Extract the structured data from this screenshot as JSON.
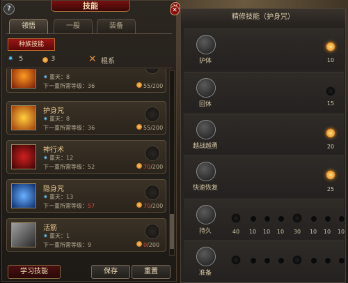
{
  "left": {
    "help": "?",
    "title": "技能",
    "tabs": [
      "领悟",
      "一般",
      "装备"
    ],
    "race_tab": "种族技能",
    "stats": {
      "blue": "5",
      "orange": "3",
      "weapon": "棍系"
    },
    "cards": [
      {
        "name": "",
        "lvl": "重天：8",
        "need_label": "下一重所需等级：",
        "need": "36",
        "need_red": false,
        "pts_cur": "55",
        "pts_max": "/200",
        "pts_red": false,
        "icon": "fire-skill-icon"
      },
      {
        "name": "护身咒",
        "lvl": "重天：8",
        "need_label": "下一重所需等级：",
        "need": "36",
        "need_red": false,
        "pts_cur": "55",
        "pts_max": "/200",
        "pts_red": false,
        "icon": "shield-spell-icon"
      },
      {
        "name": "神行术",
        "lvl": "重天：12",
        "need_label": "下一重所需等级：",
        "need": "52",
        "need_red": false,
        "pts_cur": "70",
        "pts_max": "/200",
        "pts_red": true,
        "icon": "swift-walk-icon"
      },
      {
        "name": "隐身咒",
        "lvl": "重天：13",
        "need_label": "下一重所需等级：",
        "need": "57",
        "need_red": true,
        "pts_cur": "70",
        "pts_max": "/200",
        "pts_red": true,
        "icon": "stealth-spell-icon"
      },
      {
        "name": "活筋",
        "lvl": "重天：1",
        "need_label": "下一重所需等级：",
        "need": "9",
        "need_red": false,
        "pts_cur": "0",
        "pts_max": "/200",
        "pts_red": true,
        "icon": "tendon-skill-icon"
      }
    ],
    "buttons": {
      "learn": "学习技能",
      "save": "保存",
      "reset": "重置"
    }
  },
  "right": {
    "title": "精修技能（护身咒）",
    "rows": [
      {
        "name": "护体",
        "value": "10",
        "on": true
      },
      {
        "name": "回体",
        "value": "15",
        "on": false
      },
      {
        "name": "越战越勇",
        "value": "20",
        "on": true
      },
      {
        "name": "快速恢复",
        "value": "25",
        "on": true
      },
      {
        "name": "持久",
        "multi": [
          "40",
          "10",
          "10",
          "10",
          "30",
          "10",
          "10",
          "10"
        ]
      },
      {
        "name": "准备",
        "multi": [
          "40",
          "10",
          "10",
          "10",
          "30",
          "10",
          "10",
          "10"
        ]
      }
    ]
  },
  "colors": {
    "accent": "#9a1414",
    "gold": "#e8c890",
    "warn": "#e04a3a"
  }
}
